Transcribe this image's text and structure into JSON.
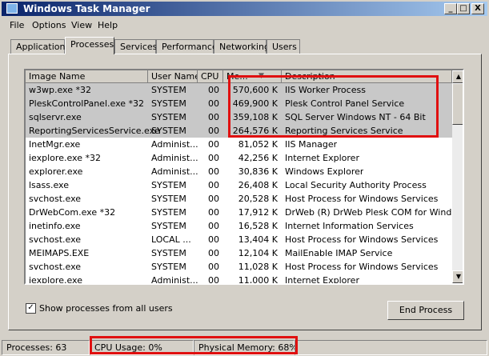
{
  "window": {
    "title": "Windows Task Manager",
    "controls": {
      "minimize": "_",
      "maximize": "□",
      "close": "X"
    }
  },
  "menu": [
    "File",
    "Options",
    "View",
    "Help"
  ],
  "tabs": [
    "Applications",
    "Processes",
    "Services",
    "Performance",
    "Networking",
    "Users"
  ],
  "active_tab": "Processes",
  "table": {
    "columns": [
      "Image Name",
      "User Name",
      "CPU",
      "Me...",
      "Description"
    ],
    "sort_column": "Me...",
    "rows": [
      {
        "name": "w3wp.exe *32",
        "user": "SYSTEM",
        "cpu": "00",
        "mem": "570,600 K",
        "desc": "IIS Worker Process"
      },
      {
        "name": "PleskControlPanel.exe *32",
        "user": "SYSTEM",
        "cpu": "00",
        "mem": "469,900 K",
        "desc": "Plesk Control Panel Service"
      },
      {
        "name": "sqlservr.exe",
        "user": "SYSTEM",
        "cpu": "00",
        "mem": "359,108 K",
        "desc": "SQL Server Windows NT - 64 Bit"
      },
      {
        "name": "ReportingServicesService.exe",
        "user": "SYSTEM",
        "cpu": "00",
        "mem": "264,576 K",
        "desc": "Reporting Services Service"
      },
      {
        "name": "InetMgr.exe",
        "user": "Administ...",
        "cpu": "00",
        "mem": "81,052 K",
        "desc": "IIS Manager"
      },
      {
        "name": "iexplore.exe *32",
        "user": "Administ...",
        "cpu": "00",
        "mem": "42,256 K",
        "desc": "Internet Explorer"
      },
      {
        "name": "explorer.exe",
        "user": "Administ...",
        "cpu": "00",
        "mem": "30,836 K",
        "desc": "Windows Explorer"
      },
      {
        "name": "lsass.exe",
        "user": "SYSTEM",
        "cpu": "00",
        "mem": "26,408 K",
        "desc": "Local Security Authority Process"
      },
      {
        "name": "svchost.exe",
        "user": "SYSTEM",
        "cpu": "00",
        "mem": "20,528 K",
        "desc": "Host Process for Windows Services"
      },
      {
        "name": "DrWebCom.exe *32",
        "user": "SYSTEM",
        "cpu": "00",
        "mem": "17,912 K",
        "desc": "DrWeb (R) DrWeb Plesk COM for Windows"
      },
      {
        "name": "inetinfo.exe",
        "user": "SYSTEM",
        "cpu": "00",
        "mem": "16,528 K",
        "desc": "Internet Information Services"
      },
      {
        "name": "svchost.exe",
        "user": "LOCAL ...",
        "cpu": "00",
        "mem": "13,404 K",
        "desc": "Host Process for Windows Services"
      },
      {
        "name": "MEIMAPS.EXE",
        "user": "SYSTEM",
        "cpu": "00",
        "mem": "12,104 K",
        "desc": "MailEnable IMAP Service"
      },
      {
        "name": "svchost.exe",
        "user": "SYSTEM",
        "cpu": "00",
        "mem": "11,028 K",
        "desc": "Host Process for Windows Services"
      },
      {
        "name": "iexplore.exe",
        "user": "Administ...",
        "cpu": "00",
        "mem": "11,000 K",
        "desc": "Internet Explorer"
      }
    ],
    "highlighted_rows": 4
  },
  "show_all_users": {
    "label": "Show processes from all users",
    "checked": true,
    "check_glyph": "✓"
  },
  "end_process_label": "End Process",
  "status": {
    "processes": "Processes: 63",
    "cpu": "CPU Usage: 0%",
    "memory": "Physical Memory: 68%"
  },
  "colors": {
    "highlight_box": "#e01010",
    "title_start": "#0a246a",
    "title_end": "#a6caf0"
  }
}
